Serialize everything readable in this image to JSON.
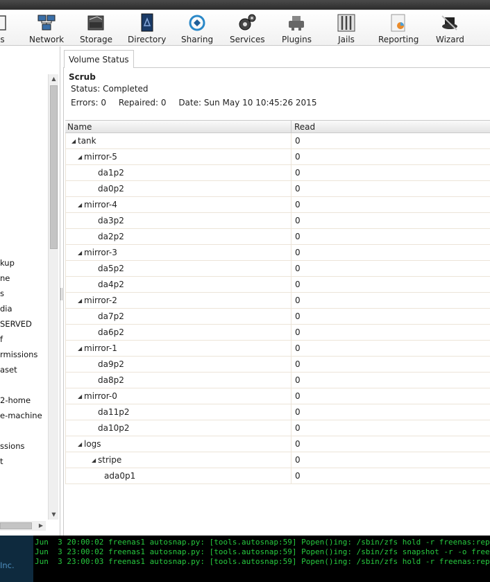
{
  "toolbar": {
    "items": [
      {
        "label": "ks",
        "icon": "tasks-icon"
      },
      {
        "label": "Network",
        "icon": "network-icon"
      },
      {
        "label": "Storage",
        "icon": "storage-icon"
      },
      {
        "label": "Directory",
        "icon": "directory-icon"
      },
      {
        "label": "Sharing",
        "icon": "sharing-icon"
      },
      {
        "label": "Services",
        "icon": "services-icon"
      },
      {
        "label": "Plugins",
        "icon": "plugins-icon"
      },
      {
        "label": "Jails",
        "icon": "jails-icon"
      },
      {
        "label": "Reporting",
        "icon": "reporting-icon"
      },
      {
        "label": "Wizard",
        "icon": "wizard-icon"
      }
    ]
  },
  "left_tree": {
    "items": [
      "kup",
      "ne",
      "s",
      "dia",
      "SERVED",
      "f",
      "rmissions",
      "aset",
      "",
      "2-home",
      "e-machine",
      "",
      "ssions",
      "t"
    ],
    "highlight_color": "#29b6e8"
  },
  "tab": {
    "label": "Volume Status"
  },
  "scrub": {
    "title": "Scrub",
    "status": "Status: Completed",
    "errors": "Errors: 0",
    "repaired": "Repaired: 0",
    "date": "Date: Sun May 10 10:45:26 2015"
  },
  "grid": {
    "columns": {
      "name": "Name",
      "read": "Read"
    },
    "rows": [
      {
        "name": "tank",
        "read": "0",
        "level": 0,
        "expander": true
      },
      {
        "name": "mirror-5",
        "read": "0",
        "level": 1,
        "expander": true
      },
      {
        "name": "da1p2",
        "read": "0",
        "level": 2,
        "expander": false
      },
      {
        "name": "da0p2",
        "read": "0",
        "level": 2,
        "expander": false
      },
      {
        "name": "mirror-4",
        "read": "0",
        "level": 1,
        "expander": true
      },
      {
        "name": "da3p2",
        "read": "0",
        "level": 2,
        "expander": false
      },
      {
        "name": "da2p2",
        "read": "0",
        "level": 2,
        "expander": false
      },
      {
        "name": "mirror-3",
        "read": "0",
        "level": 1,
        "expander": true
      },
      {
        "name": "da5p2",
        "read": "0",
        "level": 2,
        "expander": false
      },
      {
        "name": "da4p2",
        "read": "0",
        "level": 2,
        "expander": false
      },
      {
        "name": "mirror-2",
        "read": "0",
        "level": 1,
        "expander": true
      },
      {
        "name": "da7p2",
        "read": "0",
        "level": 2,
        "expander": false
      },
      {
        "name": "da6p2",
        "read": "0",
        "level": 2,
        "expander": false
      },
      {
        "name": "mirror-1",
        "read": "0",
        "level": 1,
        "expander": true
      },
      {
        "name": "da9p2",
        "read": "0",
        "level": 2,
        "expander": false
      },
      {
        "name": "da8p2",
        "read": "0",
        "level": 2,
        "expander": false
      },
      {
        "name": "mirror-0",
        "read": "0",
        "level": 1,
        "expander": true
      },
      {
        "name": "da11p2",
        "read": "0",
        "level": 2,
        "expander": false
      },
      {
        "name": "da10p2",
        "read": "0",
        "level": 2,
        "expander": false
      },
      {
        "name": "logs",
        "read": "0",
        "level": 1,
        "expander": true
      },
      {
        "name": "stripe",
        "read": "0",
        "level": 2,
        "expander": true
      },
      {
        "name": "ada0p1",
        "read": "0",
        "level": 3,
        "expander": false
      }
    ]
  },
  "console": {
    "vendor": "Inc.",
    "lines": [
      "Jun  3 20:00:02 freenas1 autosnap.py: [tools.autosnap:59] Popen()ing: /sbin/zfs hold -r freenas:rep",
      "Jun  3 23:00:02 freenas1 autosnap.py: [tools.autosnap:59] Popen()ing: /sbin/zfs snapshot -r -o free",
      "Jun  3 23:00:03 freenas1 autosnap.py: [tools.autosnap:59] Popen()ing: /sbin/zfs hold -r freenas:rep"
    ],
    "text_color": "#27c93f"
  }
}
